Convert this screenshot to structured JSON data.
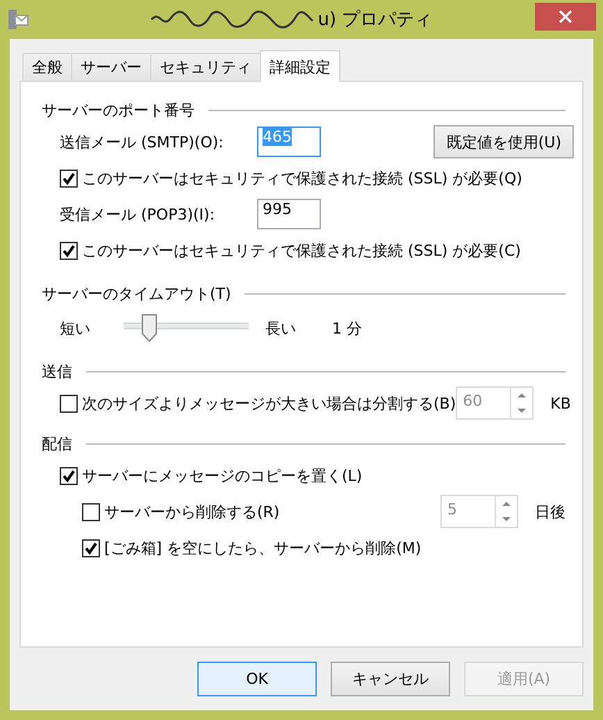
{
  "window": {
    "title": "u) プロパティ"
  },
  "tabs": [
    {
      "label": "全般",
      "selected": false
    },
    {
      "label": "サーバー",
      "selected": false
    },
    {
      "label": "セキュリティ",
      "selected": false
    },
    {
      "label": "詳細設定",
      "selected": true
    }
  ],
  "sections": [
    {
      "title": "サーバーのポート番号",
      "rows": [
        {
          "kind": "field",
          "label": "送信メール (SMTP)(O):",
          "value": "465",
          "text_selected": true,
          "button": "既定値を使用(U)"
        },
        {
          "kind": "checkbox",
          "label": "このサーバーはセキュリティで保護された接続 (SSL) が必要(Q)",
          "checked": true
        },
        {
          "kind": "field",
          "label": "受信メール (POP3)(I):",
          "value": "995",
          "text_selected": false
        },
        {
          "kind": "checkbox",
          "label": "このサーバーはセキュリティで保護された接続 (SSL) が必要(C)",
          "checked": true
        }
      ]
    },
    {
      "title": "サーバーのタイムアウト(T)",
      "rows": [
        {
          "kind": "slider",
          "min_label": "短い",
          "max_label": "長い",
          "level": 0.15,
          "reading": "1 分"
        }
      ]
    },
    {
      "title": "送信",
      "rows": [
        {
          "kind": "spin",
          "label": "次のサイズよりメッセージが大きい場合は分割する(B)",
          "checked": false,
          "value": "60",
          "unit": "KB",
          "disabled": true
        }
      ]
    },
    {
      "title": "配信",
      "rows": [
        {
          "kind": "checkbox",
          "label": "サーバーにメッセージのコピーを置く(L)",
          "checked": true,
          "children": [
            {
              "kind": "spin",
              "label": "サーバーから削除する(R)",
              "checked": false,
              "value": "5",
              "unit": "日後",
              "disabled": true
            },
            {
              "kind": "checkbox",
              "label": "[ごみ箱] を空にしたら、サーバーから削除(M)",
              "checked": true
            }
          ]
        }
      ]
    }
  ],
  "buttons": [
    {
      "label": "OK",
      "default": true,
      "disabled": false
    },
    {
      "label": "キャンセル",
      "default": false,
      "disabled": false
    },
    {
      "label": "適用(A)",
      "default": false,
      "disabled": true
    }
  ]
}
